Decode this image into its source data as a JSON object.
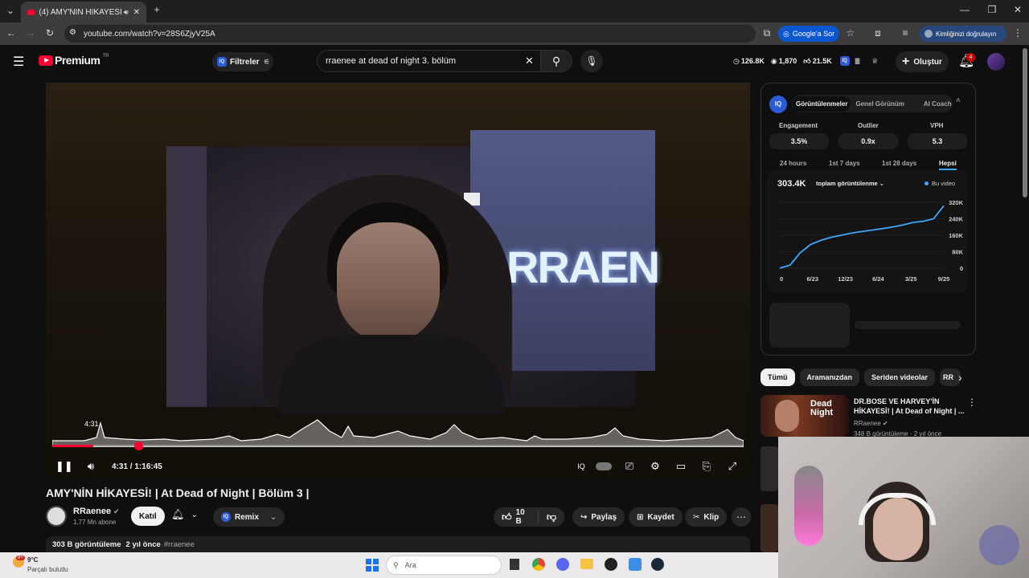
{
  "browser": {
    "tab_title": "(4) AMY'NİN HİKAYESİ! | At",
    "url": "youtube.com/watch?v=28S6ZjyV25A",
    "google_sor": "Google'a Sor",
    "identity": "Kimliğinizi doğrulayın"
  },
  "yt": {
    "logo": "Premium",
    "logo_region": "TR",
    "filters_label": "Filtreler",
    "search_query": "rraenee at dead of night 3. bölüm",
    "stats": {
      "views": "126.8K",
      "eye": "1,870",
      "likes": "21.5K"
    },
    "create_label": "Oluştur",
    "notif_count": "4"
  },
  "player": {
    "hover_time": "4:31",
    "time_current": "4:31",
    "time_sep": " / ",
    "time_total": "1:16:45",
    "progress": 0.059,
    "backdrop_text": "RRAEN"
  },
  "video": {
    "title": "AMY'NİN HİKAYESİ! | At Dead of Night | Bölüm 3 |",
    "channel": "RRaenee",
    "subs": "1,77 Mn abone",
    "join": "Katıl",
    "remix": "Remix",
    "likes": "10 B",
    "share": "Paylaş",
    "save": "Kaydet",
    "clip": "Klip",
    "desc_views": "303 B görüntüleme",
    "desc_age": "2 yıl önce",
    "desc_tag": "#rraenee"
  },
  "iq": {
    "tabs": [
      "Görüntülenmeler",
      "Genel Görünüm",
      "AI Coach"
    ],
    "stats": [
      {
        "label": "Engagement",
        "value": "3.5%"
      },
      {
        "label": "Outlier",
        "value": "0.9x"
      },
      {
        "label": "VPH",
        "value": "5.3"
      }
    ],
    "ranges": [
      "24 hours",
      "1st 7 days",
      "1st 28 days",
      "Hepsi"
    ],
    "total": "303.4K",
    "metric": "toplam görüntülenme",
    "legend": "Bu video"
  },
  "chart_data": {
    "type": "line",
    "x_ticks": [
      "0",
      "6/23",
      "12/23",
      "6/24",
      "3/25",
      "9/25"
    ],
    "y_ticks": [
      "320K",
      "240K",
      "160K",
      "80K",
      "0"
    ],
    "ylim": [
      0,
      320000
    ],
    "series": [
      {
        "name": "Bu video",
        "values": [
          0,
          15000,
          75000,
          115000,
          135000,
          150000,
          160000,
          170000,
          178000,
          185000,
          192000,
          200000,
          210000,
          222000,
          228000,
          240000,
          303400
        ]
      }
    ]
  },
  "recs": {
    "chips": [
      "Tümü",
      "Aramanızdan",
      "Seriden videolar",
      "RR"
    ],
    "items": [
      {
        "title1": "DR.BOSE VE HARVEY'İN",
        "title2": "HİKAYESİ! | At Dead of Night | ...",
        "channel": "RRaenee",
        "meta": "348 B görüntüleme · 2 yıl önce",
        "thumb_text": "Dead Night"
      }
    ]
  },
  "taskbar": {
    "temp": "9°C",
    "weather": "Parçalı bulutlu",
    "search": "Ara",
    "badge": "9+"
  },
  "colors": {
    "accent": "#ff0033",
    "iq_blue": "#3ea6ff",
    "chart_line": "#3ea6ff"
  }
}
